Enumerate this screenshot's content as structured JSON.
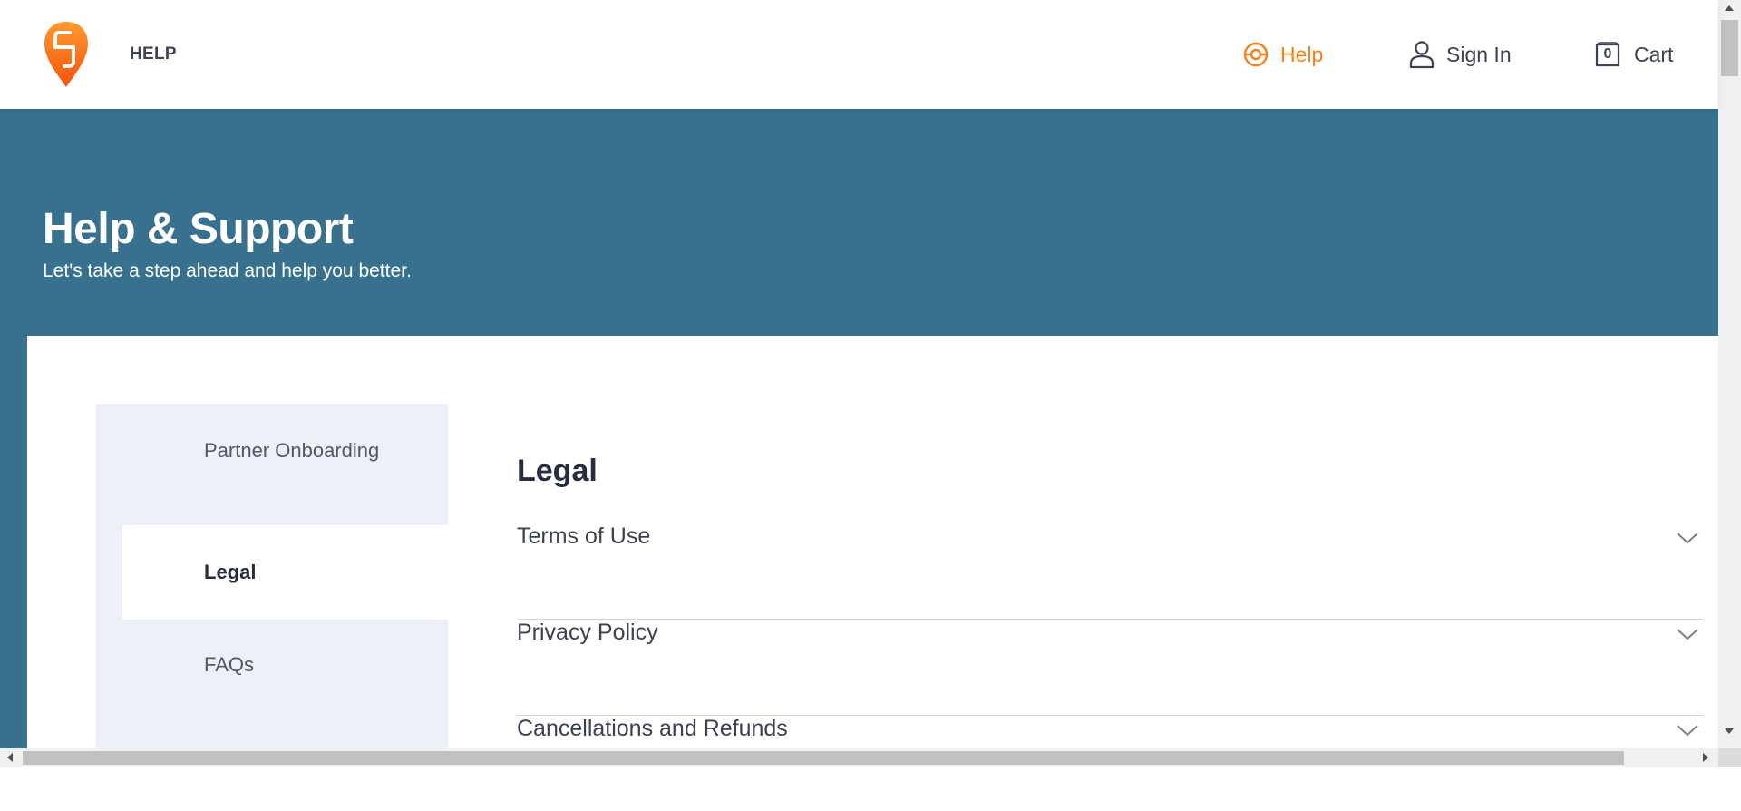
{
  "header": {
    "brand_title": "HELP",
    "nav": {
      "help_label": "Help",
      "signin_label": "Sign In",
      "cart_label": "Cart",
      "cart_count": "0"
    }
  },
  "hero": {
    "title": "Help & Support",
    "subtitle": "Let's take a step ahead and help you better."
  },
  "sidebar": {
    "items": [
      {
        "label": "Partner Onboarding"
      },
      {
        "label": "Legal"
      },
      {
        "label": "FAQs"
      }
    ]
  },
  "main": {
    "section_title": "Legal",
    "accordion": [
      {
        "label": "Terms of Use"
      },
      {
        "label": "Privacy Policy"
      },
      {
        "label": "Cancellations and Refunds"
      }
    ]
  },
  "colors": {
    "brand": "#fc8019",
    "hero_bg": "#37718e",
    "sidebar_bg": "#edf1f7",
    "text_dark": "#282c3f"
  },
  "icons": {
    "logo": "swiggy-logo-icon",
    "help": "lifebuoy-icon",
    "signin": "user-icon",
    "cart": "bag-icon",
    "accordion": "chevron-down-icon"
  }
}
